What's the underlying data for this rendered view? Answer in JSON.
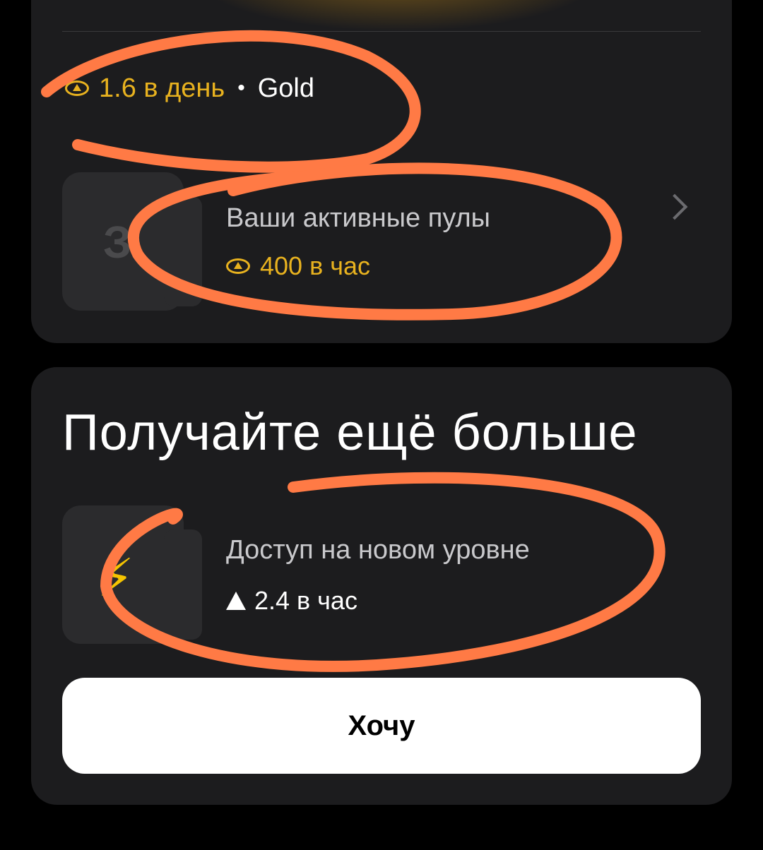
{
  "top_card": {
    "earn_rate": "1.6 в день",
    "separator": "•",
    "tier": "Gold",
    "pools_title": "Ваши активные пулы",
    "pools_rate": "400 в час",
    "pool_thumb_letter": "З"
  },
  "bottom_card": {
    "title": "Получайте ещё больше",
    "feature_title": "Доступ на новом уровне",
    "feature_rate": "2.4 в час",
    "cta_label": "Хочу"
  },
  "icons": {
    "coin": "coin-icon",
    "chevron": "chevron-right-icon",
    "bolt": "lightning-icon",
    "triangle": "triangle-icon"
  },
  "colors": {
    "accent_gold": "#e8b21f",
    "card_bg": "#1c1c1e",
    "annotation": "#ff7a45"
  }
}
